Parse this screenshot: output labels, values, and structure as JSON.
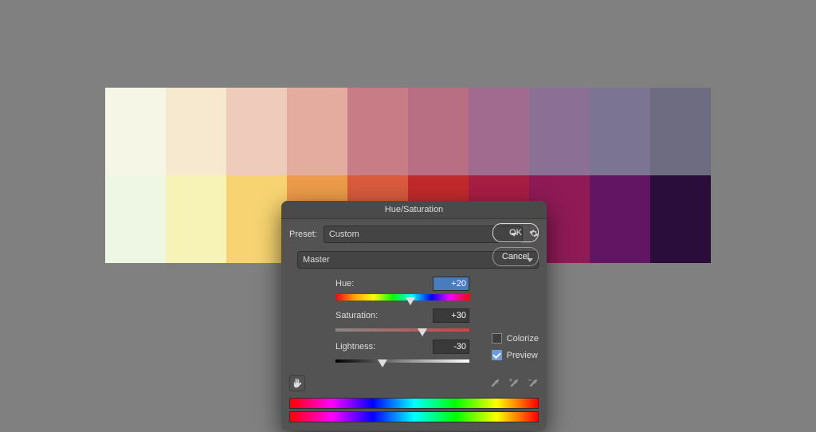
{
  "palette": {
    "row1": [
      "#f5f6e6",
      "#f6e9d0",
      "#eecbbb",
      "#e4ab9f",
      "#c77c86",
      "#b86f83",
      "#a06b8e",
      "#8b6f95",
      "#7b7492",
      "#6d6c80"
    ],
    "row2": [
      "#eef6e4",
      "#f7f3b7",
      "#f7d471",
      "#ec9b4a",
      "#d85b3e",
      "#c12a2d",
      "#a71e43",
      "#8f1a56",
      "#611563",
      "#2a0d3a"
    ]
  },
  "dialog": {
    "title": "Hue/Saturation",
    "preset_label": "Preset:",
    "preset_value": "Custom",
    "ok": "OK",
    "cancel": "Cancel",
    "range_value": "Master",
    "hue_label": "Hue:",
    "hue_value": "+20",
    "sat_label": "Saturation:",
    "sat_value": "+30",
    "light_label": "Lightness:",
    "light_value": "-30",
    "colorize": "Colorize",
    "preview": "Preview"
  }
}
